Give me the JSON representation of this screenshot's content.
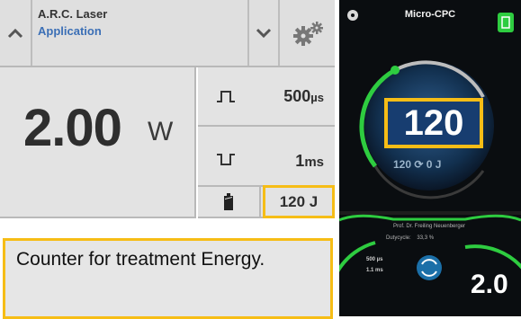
{
  "header": {
    "app_name": "A.R.C. Laser",
    "subtitle": "Application"
  },
  "power": {
    "value": "2.00",
    "unit": "W"
  },
  "pulse": {
    "value": "500",
    "unit": "µs"
  },
  "off_time": {
    "value": "1",
    "unit": "ms"
  },
  "energy": {
    "value": "120 J"
  },
  "caption": "Counter for treatment Energy.",
  "device": {
    "title": "Micro-CPC",
    "counter": "120",
    "sub_counter": "120 ⟳ 0 J",
    "info": "Prof. Dr. Freiling Neuenberger",
    "duty_label": "Dutycycle:",
    "duty_value": "33,3 %",
    "mini_pulse": "500 µs",
    "mini_off": "1.1 ms",
    "big_value": "2.0"
  },
  "colors": {
    "highlight": "#f6bd16",
    "accent_green": "#2ecc40",
    "link_blue": "#3b6fb6"
  }
}
